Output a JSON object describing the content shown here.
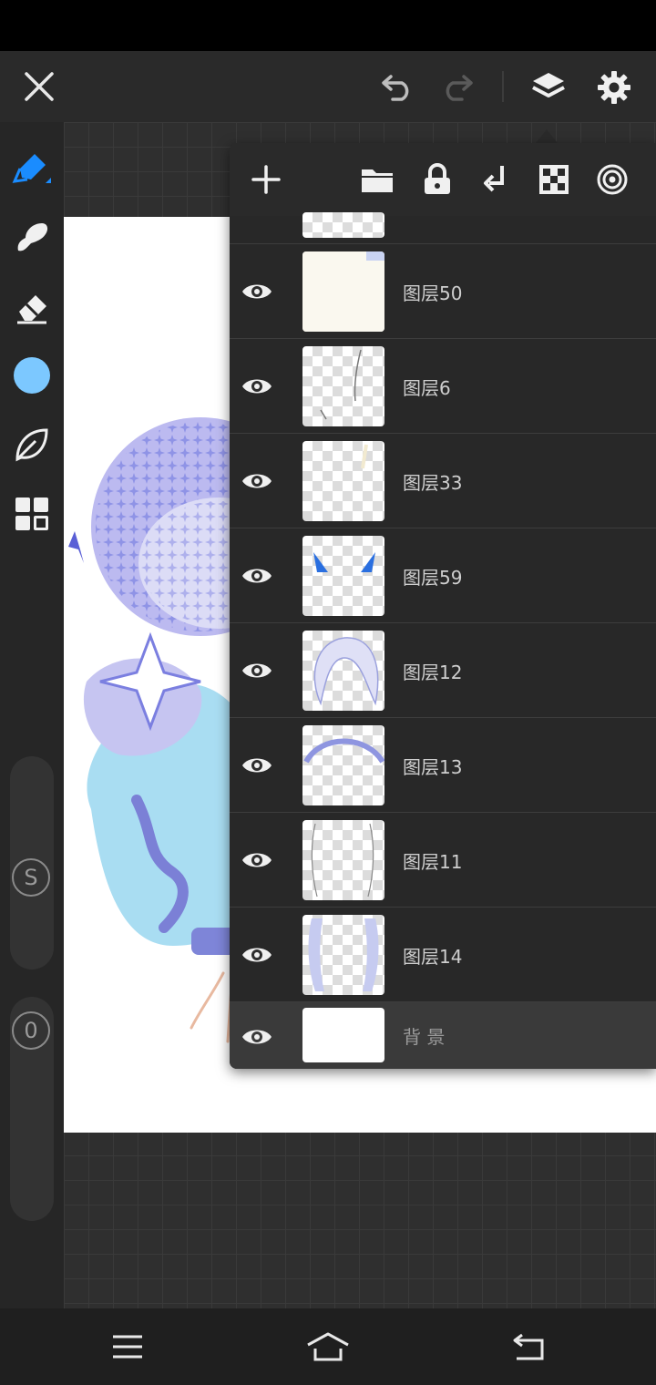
{
  "colors": {
    "accent": "#1a8cff",
    "brush_color": "#7cc8ff",
    "panel_bg": "#2d2d2d"
  },
  "topbar": {
    "close_icon": "close-icon",
    "undo_icon": "undo-icon",
    "redo_icon": "redo-icon",
    "layers_icon": "layers-icon",
    "settings_icon": "gear-icon"
  },
  "tools": [
    {
      "name": "pen",
      "icon": "pen-icon"
    },
    {
      "name": "smudge",
      "icon": "smudge-icon"
    },
    {
      "name": "eraser",
      "icon": "eraser-icon"
    },
    {
      "name": "color",
      "icon": "color-swatch"
    },
    {
      "name": "leaf",
      "icon": "leaf-icon"
    },
    {
      "name": "grid",
      "icon": "grid-icon"
    }
  ],
  "sliders": {
    "size_label": "S",
    "opacity_label": "0"
  },
  "layers_panel": {
    "toolbar_icons": [
      "add-icon",
      "folder-icon",
      "lock-icon",
      "merge-down-icon",
      "transparency-icon",
      "blend-icon"
    ],
    "layers": [
      {
        "name": "图层50"
      },
      {
        "name": "图层6"
      },
      {
        "name": "图层33"
      },
      {
        "name": "图层59"
      },
      {
        "name": "图层12"
      },
      {
        "name": "图层13"
      },
      {
        "name": "图层11"
      },
      {
        "name": "图层14"
      },
      {
        "name": "背 景"
      }
    ]
  },
  "navbar": {
    "menu_icon": "menu-icon",
    "home_icon": "home-icon",
    "back_icon": "back-icon"
  }
}
